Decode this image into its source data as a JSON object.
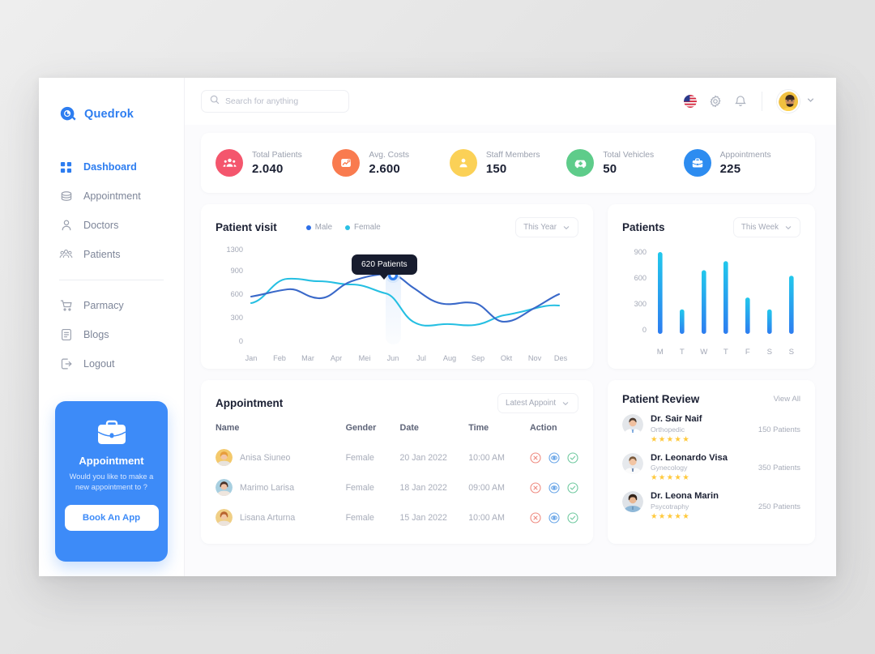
{
  "brand": {
    "name": "Quedrok",
    "logo_icon": "quedrok-logo-icon"
  },
  "sidebar": {
    "items": [
      {
        "label": "Dashboard",
        "icon": "grid-icon",
        "active": true
      },
      {
        "label": "Appointment",
        "icon": "calendar-icon",
        "active": false
      },
      {
        "label": "Doctors",
        "icon": "user-icon",
        "active": false
      },
      {
        "label": "Patients",
        "icon": "users-icon",
        "active": false
      },
      {
        "label": "Parmacy",
        "icon": "cart-icon",
        "active": false
      },
      {
        "label": "Blogs",
        "icon": "document-icon",
        "active": false
      },
      {
        "label": "Logout",
        "icon": "logout-icon",
        "active": false
      }
    ],
    "promo": {
      "icon": "briefcase-icon",
      "title": "Appointment",
      "subtitle": "Would you like to make a new appointment to ?",
      "button_label": "Book An App",
      "bg_color": "#3d8bf8"
    }
  },
  "header": {
    "search_placeholder": "Search for anything",
    "search_value": "",
    "search_icon": "search-icon",
    "flag_icon": "us-flag-icon",
    "settings_icon": "gear-icon",
    "notification_icon": "bell-icon",
    "avatar_icon": "user-avatar",
    "chevron_icon": "chevron-down-icon"
  },
  "stats": [
    {
      "label": "Total Patients",
      "value": "2.040",
      "icon": "patients-group-icon",
      "color": "#f4566d"
    },
    {
      "label": "Avg. Costs",
      "value": "2.600",
      "icon": "chart-up-icon",
      "color": "#f97b4f"
    },
    {
      "label": "Staff Members",
      "value": "150",
      "icon": "staff-person-icon",
      "color": "#fbd157"
    },
    {
      "label": "Total Vehicles",
      "value": "50",
      "icon": "ambulance-icon",
      "color": "#5ecc8a"
    },
    {
      "label": "Appointments",
      "value": "225",
      "icon": "briefcase-icon",
      "color": "#2d8cf0"
    }
  ],
  "patient_visit": {
    "title": "Patient visit",
    "filter_label": "This Year",
    "filter_icon": "chevron-down-icon",
    "legend": [
      {
        "label": "Male",
        "color": "#2d6fe8"
      },
      {
        "label": "Female",
        "color": "#2bc0e4"
      }
    ],
    "tooltip": "620 Patients"
  },
  "patients_chart": {
    "title": "Patients",
    "filter_label": "This Week",
    "filter_icon": "chevron-down-icon"
  },
  "appointment": {
    "title": "Appointment",
    "filter_label": "Latest Appoint",
    "filter_icon": "chevron-down-icon",
    "columns": [
      "Name",
      "Gender",
      "Date",
      "Time",
      "Action"
    ],
    "rows": [
      {
        "name": "Anisa Siuneo",
        "gender": "Female",
        "date": "20 Jan 2022",
        "time": "10:00 AM",
        "actions": [
          "cancel-icon",
          "view-icon",
          "approve-icon"
        ]
      },
      {
        "name": "Marimo Larisa",
        "gender": "Female",
        "date": "18 Jan 2022",
        "time": "09:00 AM",
        "actions": [
          "cancel-icon",
          "view-icon",
          "approve-icon"
        ]
      },
      {
        "name": "Lisana Arturna",
        "gender": "Female",
        "date": "15 Jan 2022",
        "time": "10:00 AM",
        "actions": [
          "cancel-icon",
          "view-icon",
          "approve-icon"
        ]
      }
    ]
  },
  "patient_review": {
    "title": "Patient Review",
    "view_all_label": "View All",
    "doctors": [
      {
        "name": "Dr. Sair Naif",
        "specialty": "Orthopedic",
        "stars": "★★★★★",
        "patients": "150 Patients"
      },
      {
        "name": "Dr. Leonardo Visa",
        "specialty": "Gynecology",
        "stars": "★★★★★",
        "patients": "350 Patients"
      },
      {
        "name": "Dr. Leona Marin",
        "specialty": "Psycotraphy",
        "stars": "★★★★★",
        "patients": "250 Patients"
      }
    ]
  },
  "chart_data": [
    {
      "type": "line",
      "title": "Patient visit",
      "xlabel": "",
      "ylabel": "",
      "categories": [
        "Jan",
        "Feb",
        "Mar",
        "Apr",
        "Mei",
        "Jun",
        "Jul",
        "Aug",
        "Sep",
        "Okt",
        "Nov",
        "Des"
      ],
      "tick_labels_y": [
        "0",
        "300",
        "600",
        "900",
        "1300"
      ],
      "ylim": [
        0,
        1300
      ],
      "grid": false,
      "legend_position": "top-center",
      "annotation": "620 Patients",
      "annotation_point": {
        "series": "Male",
        "x": "Jun",
        "y": 620
      },
      "series": [
        {
          "name": "Male",
          "color": "#2d6fe8",
          "values": [
            600,
            640,
            620,
            570,
            700,
            740,
            700,
            560,
            540,
            520,
            340,
            600
          ]
        },
        {
          "name": "Female",
          "color": "#2bc0e4",
          "values": [
            520,
            690,
            680,
            640,
            650,
            620,
            320,
            270,
            280,
            350,
            440,
            480
          ]
        }
      ]
    },
    {
      "type": "bar",
      "title": "Patients",
      "xlabel": "",
      "ylabel": "",
      "categories": [
        "M",
        "T",
        "W",
        "T",
        "F",
        "S",
        "S"
      ],
      "tick_labels_y": [
        "0",
        "300",
        "600",
        "900"
      ],
      "ylim": [
        0,
        900
      ],
      "grid": false,
      "bar_gradient": {
        "bottom": "#2d7df0",
        "top": "#22c8ec"
      },
      "values": [
        900,
        270,
        700,
        800,
        400,
        270,
        640
      ]
    }
  ]
}
